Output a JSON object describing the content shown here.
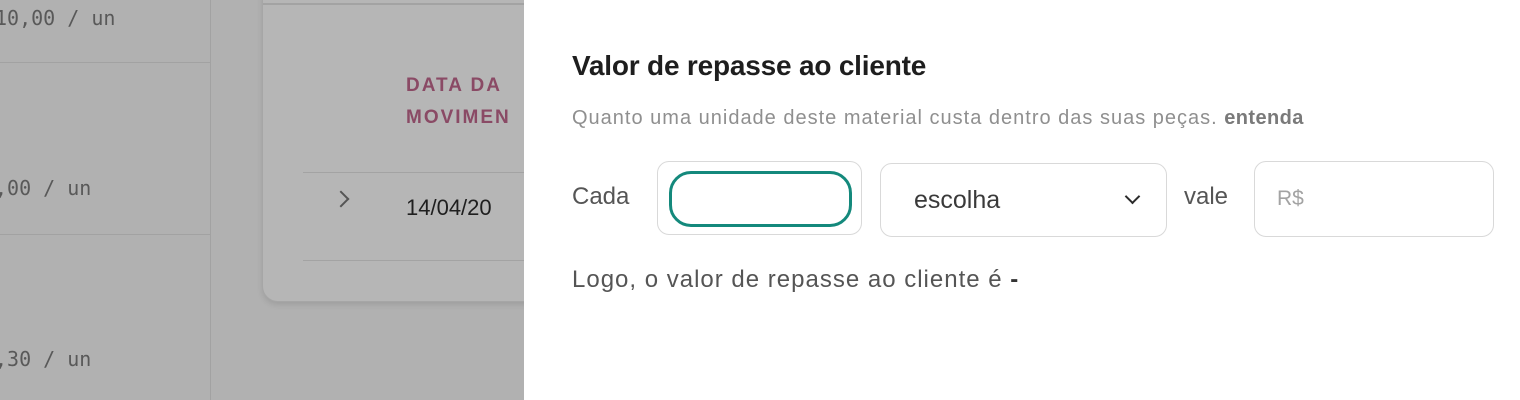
{
  "background": {
    "prices": [
      "10,00 / un",
      ",00 / un",
      ",30 / un"
    ],
    "table": {
      "column_header": "DATA DA\nMOVIMEN",
      "row_date": "14/04/20"
    }
  },
  "panel": {
    "title": "Valor de repasse ao cliente",
    "subtitle": "Quanto uma unidade deste material custa dentro das suas peças.",
    "subtitle_link": "entenda",
    "form": {
      "each_label": "Cada",
      "quantity_value": "",
      "unit_select": {
        "selected": "escolha"
      },
      "worth_label": "vale",
      "value_placeholder": "R$"
    },
    "result_text": "Logo, o valor de repasse ao cliente é",
    "result_value": "-"
  },
  "colors": {
    "overlay_gray": "#b2b2b2",
    "header_accent": "#8a4a65",
    "focus_teal": "#14897c",
    "panel_bg": "#ffffff"
  },
  "icons": [
    "chevron-right-icon",
    "chevron-down-icon"
  ]
}
